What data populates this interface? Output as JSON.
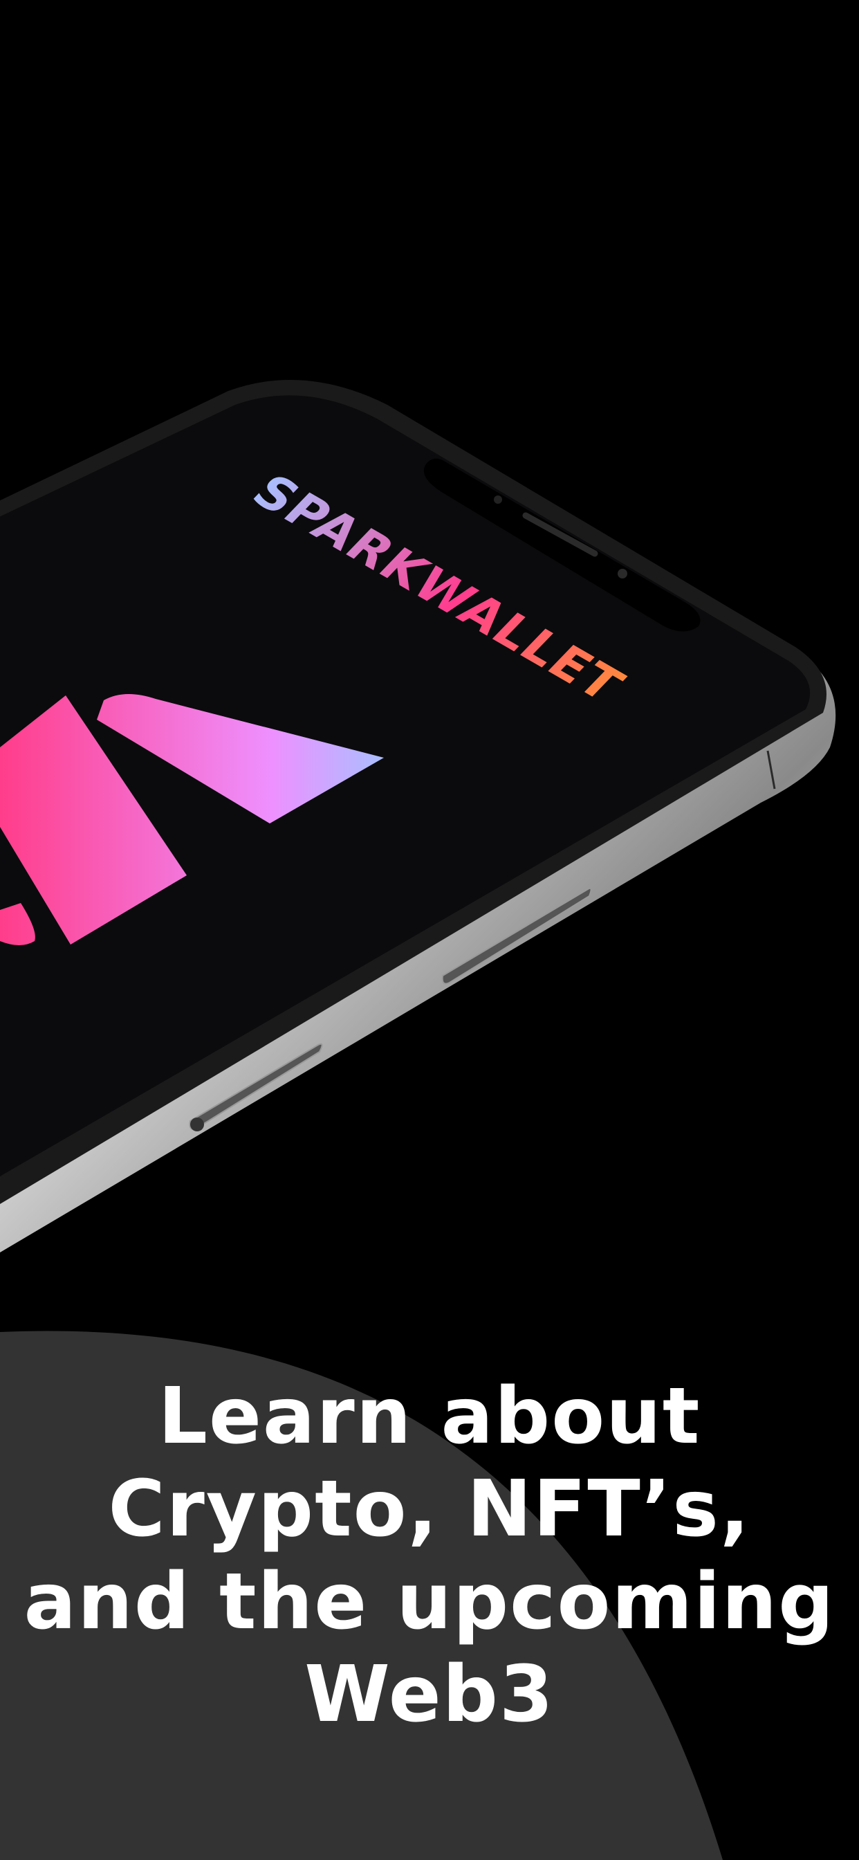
{
  "brand": {
    "name": "SPARKWALLET",
    "gradient": [
      "#a8c0ff",
      "#ff3d8f",
      "#ff8a3d"
    ]
  },
  "logo_gradient": [
    "#ff3d8a",
    "#ee90ff",
    "#a8c0ff"
  ],
  "headline": {
    "lines": [
      "Learn about",
      "Crypto, NFT’s,",
      "and the upcoming",
      "Web3"
    ]
  },
  "colors": {
    "background": "#000000",
    "blob": "#333333",
    "text": "#ffffff",
    "phone_screen": "#0b0b0d"
  }
}
